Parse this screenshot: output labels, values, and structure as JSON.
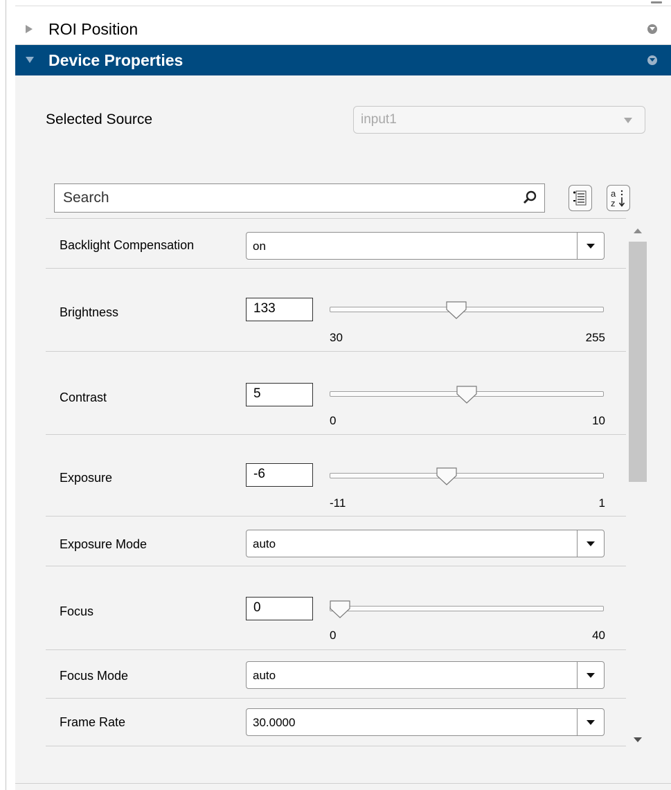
{
  "sections": [
    {
      "title": "ROI Position",
      "expanded": false
    },
    {
      "title": "Device Properties",
      "expanded": true
    }
  ],
  "source": {
    "label": "Selected Source",
    "value": "input1"
  },
  "search": {
    "placeholder": "Search"
  },
  "properties": [
    {
      "label": "Backlight Compensation",
      "kind": "dropdown",
      "value": "on"
    },
    {
      "label": "Brightness",
      "kind": "slider",
      "value": "133",
      "min": "30",
      "max": "255",
      "level": 0.46
    },
    {
      "label": "Contrast",
      "kind": "slider",
      "value": "5",
      "min": "0",
      "max": "10",
      "level": 0.5
    },
    {
      "label": "Exposure",
      "kind": "slider",
      "value": "-6",
      "min": "-11",
      "max": "1",
      "level": 0.42
    },
    {
      "label": "Exposure Mode",
      "kind": "dropdown",
      "value": "auto"
    },
    {
      "label": "Focus",
      "kind": "slider",
      "value": "0",
      "min": "0",
      "max": "40",
      "level": 0.0
    },
    {
      "label": "Focus Mode",
      "kind": "dropdown",
      "value": "auto"
    },
    {
      "label": "Frame Rate",
      "kind": "dropdown",
      "value": "30.0000"
    }
  ],
  "colors": {
    "header_active": "#004a80",
    "panel_bg": "#f3f3f3"
  }
}
